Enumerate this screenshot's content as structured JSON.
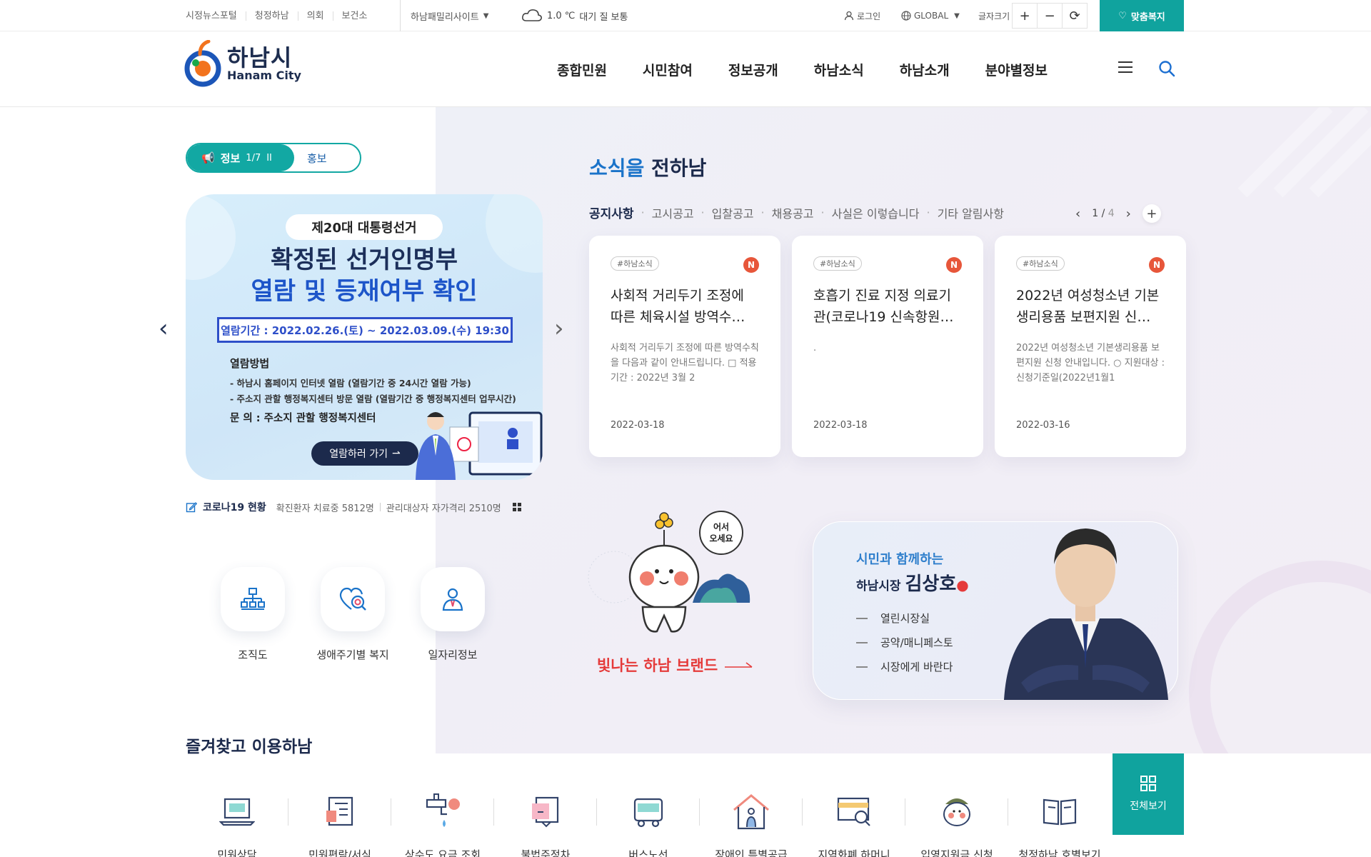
{
  "topbar": {
    "links": [
      "시정뉴스포털",
      "청정하남",
      "의회",
      "보건소"
    ],
    "family_site": "하남패밀리사이트",
    "weather_temp": "1.0 ℃",
    "weather_air": "대기 질 보통",
    "login": "로그인",
    "global": "GLOBAL",
    "fontsize_label": "글자크기",
    "fontsize_plus": "+",
    "fontsize_minus": "−",
    "fontsize_reset": "⟳",
    "welfare": "맞춤복지"
  },
  "header": {
    "logo_ko": "하남시",
    "logo_en": "Hanam City",
    "nav": [
      "종합민원",
      "시민참여",
      "정보공개",
      "하남소식",
      "하남소개",
      "분야별정보"
    ]
  },
  "slider": {
    "tab_info": "정보",
    "tab_counter": "1/7",
    "tab_pause": "II",
    "tab_pr": "홍보",
    "banner": {
      "pill": "제20대 대통령선거",
      "headline_1": "확정된 선거인명부",
      "headline_2": "열람 및 등재여부 확인",
      "period": "열람기간 : 2022.02.26.(토) ~ 2022.03.09.(수) 19:30",
      "method_title": "열람방법",
      "method_1": "- 하남시 홈페이지 인터넷 열람 (열람기간 중 24시간 열람 가능)",
      "method_2": "- 주소지 관할 행정복지센터 방문 열람 (열람기간 중 행정복지센터 업무시간)",
      "contact": "문  의 : 주소지 관할 행정복지센터",
      "button": "열람하러 가기"
    }
  },
  "covid": {
    "title": "코로나19 현황",
    "confirmed": "확진환자 치료중 5812명",
    "quarantine": "관리대상자 자가격리 2510명"
  },
  "quick": [
    "조직도",
    "생애주기별 복지",
    "일자리정보"
  ],
  "news": {
    "title_a": "소식을",
    "title_b": "전하남",
    "tabs": [
      "공지사항",
      "고시공고",
      "입찰공고",
      "채용공고",
      "사실은 이렇습니다",
      "기타 알림사항"
    ],
    "page": "1",
    "page_total": "4",
    "cards": [
      {
        "tag": "#하남소식",
        "badge": "N",
        "title": "사회적 거리두기 조정에 따른 체육시설 방역수…",
        "desc": "사회적 거리두기 조정에 따른 방역수칙을 다음과 같이 안내드립니다. □ 적용기간 : 2022년 3월 2",
        "date": "2022-03-18"
      },
      {
        "tag": "#하남소식",
        "badge": "N",
        "title": "호흡기 진료 지정 의료기관(코로나19 신속항원…",
        "desc": ".",
        "date": "2022-03-18"
      },
      {
        "tag": "#하남소식",
        "badge": "N",
        "title": "2022년 여성청소년 기본 생리용품 보편지원 신…",
        "desc": "2022년 여성청소년 기본생리용품 보편지원 신청 안내입니다. ○ 지원대상 : 신청기준일(2022년1월1",
        "date": "2022-03-16"
      }
    ]
  },
  "brand": {
    "bubble": "어서\n오세요",
    "text": "빛나는 하남 브랜드"
  },
  "mayor": {
    "subtitle": "시민과 함께하는",
    "prefix": "하남시장",
    "name": "김상호",
    "links": [
      "열린시장실",
      "공약/매니페스토",
      "시장에게 바란다"
    ]
  },
  "favorites": {
    "title": "즐겨찾고 이용하남",
    "view_all": "전체보기",
    "items": [
      "민원상담",
      "민원편람/서식",
      "상수도 요금 조회",
      "불법주정차",
      "버스노선",
      "장애인 특별공급",
      "지역화폐 하머니",
      "입영지원금 신청",
      "청정하남 호별보기"
    ]
  }
}
